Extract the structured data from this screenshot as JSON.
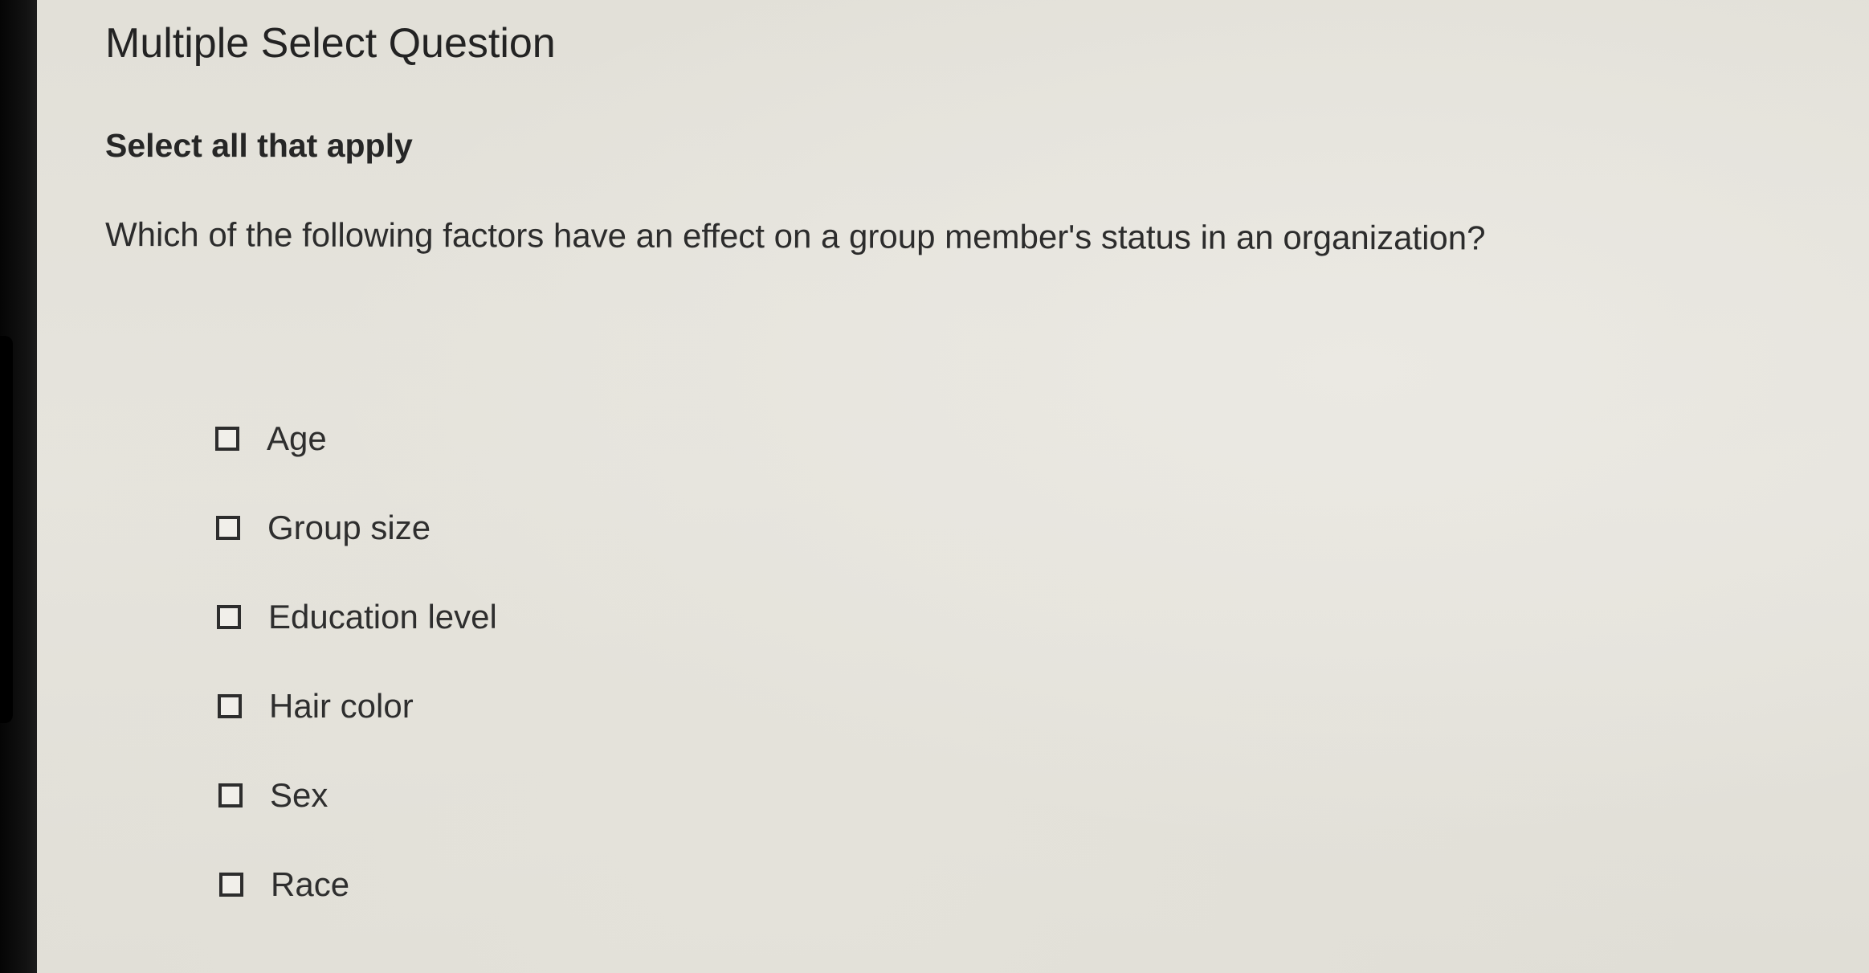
{
  "question": {
    "type_title": "Multiple Select Question",
    "instruction": "Select all that apply",
    "prompt": "Which of the following factors have an effect on a group member's status in an organization?",
    "options": [
      {
        "label": "Age",
        "checked": false
      },
      {
        "label": "Group size",
        "checked": false
      },
      {
        "label": "Education level",
        "checked": false
      },
      {
        "label": "Hair color",
        "checked": false
      },
      {
        "label": "Sex",
        "checked": false
      },
      {
        "label": "Race",
        "checked": false
      }
    ]
  },
  "colors": {
    "background": "#e3e1da",
    "text": "#2a2a2a",
    "checkbox_border": "#2d2d2d"
  }
}
